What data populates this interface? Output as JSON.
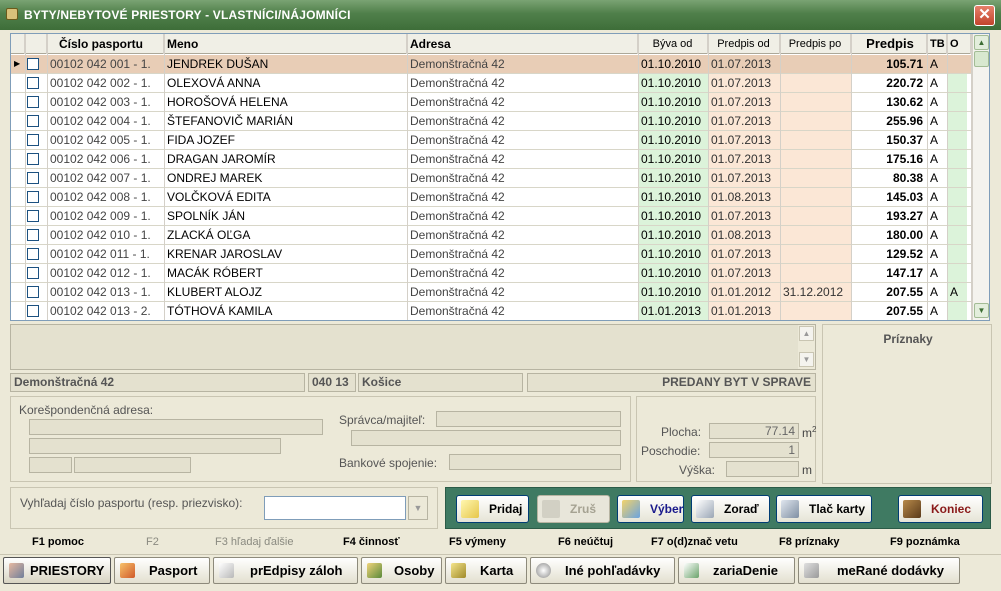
{
  "window": {
    "title": "BYTY/NEBYTOVÉ PRIESTORY - VLASTNÍCI/NÁJOMNÍCI",
    "close_label": "✕"
  },
  "grid": {
    "columns": {
      "pasport": "Číslo pasportu",
      "meno": "Meno",
      "adresa": "Adresa",
      "byva_od": "Býva od",
      "predpis_od": "Predpis od",
      "predpis_po": "Predpis po",
      "predpis": "Predpis",
      "tb": "TB",
      "o": "O"
    },
    "rows": [
      {
        "pasport": "00102 042 001 - 1.",
        "meno": "JENDREK DUŠAN",
        "adresa": "Demonštračná 42",
        "byva_od": "01.10.2010",
        "predpis_od": "01.07.2013",
        "predpis_po": "",
        "predpis": "105.71",
        "tb": "A",
        "o": ""
      },
      {
        "pasport": "00102 042 002 - 1.",
        "meno": "OLEXOVÁ ANNA",
        "adresa": "Demonštračná 42",
        "byva_od": "01.10.2010",
        "predpis_od": "01.07.2013",
        "predpis_po": "",
        "predpis": "220.72",
        "tb": "A",
        "o": ""
      },
      {
        "pasport": "00102 042 003 - 1.",
        "meno": "HOROŠOVÁ HELENA",
        "adresa": "Demonštračná 42",
        "byva_od": "01.10.2010",
        "predpis_od": "01.07.2013",
        "predpis_po": "",
        "predpis": "130.62",
        "tb": "A",
        "o": ""
      },
      {
        "pasport": "00102 042 004 - 1.",
        "meno": "ŠTEFANOVIČ MARIÁN",
        "adresa": "Demonštračná 42",
        "byva_od": "01.10.2010",
        "predpis_od": "01.07.2013",
        "predpis_po": "",
        "predpis": "255.96",
        "tb": "A",
        "o": ""
      },
      {
        "pasport": "00102 042 005 - 1.",
        "meno": "FIDA JOZEF",
        "adresa": "Demonštračná 42",
        "byva_od": "01.10.2010",
        "predpis_od": "01.07.2013",
        "predpis_po": "",
        "predpis": "150.37",
        "tb": "A",
        "o": ""
      },
      {
        "pasport": "00102 042 006 - 1.",
        "meno": "DRAGAN JAROMÍR",
        "adresa": "Demonštračná 42",
        "byva_od": "01.10.2010",
        "predpis_od": "01.07.2013",
        "predpis_po": "",
        "predpis": "175.16",
        "tb": "A",
        "o": ""
      },
      {
        "pasport": "00102 042 007 - 1.",
        "meno": "ONDREJ MAREK",
        "adresa": "Demonštračná 42",
        "byva_od": "01.10.2010",
        "predpis_od": "01.07.2013",
        "predpis_po": "",
        "predpis": "80.38",
        "tb": "A",
        "o": ""
      },
      {
        "pasport": "00102 042 008 - 1.",
        "meno": "VOLČKOVÁ EDITA",
        "adresa": "Demonštračná 42",
        "byva_od": "01.10.2010",
        "predpis_od": "01.08.2013",
        "predpis_po": "",
        "predpis": "145.03",
        "tb": "A",
        "o": ""
      },
      {
        "pasport": "00102 042 009 - 1.",
        "meno": "SPOLNÍK JÁN",
        "adresa": "Demonštračná 42",
        "byva_od": "01.10.2010",
        "predpis_od": "01.07.2013",
        "predpis_po": "",
        "predpis": "193.27",
        "tb": "A",
        "o": ""
      },
      {
        "pasport": "00102 042 010 - 1.",
        "meno": "ZLACKÁ OĽGA",
        "adresa": "Demonštračná 42",
        "byva_od": "01.10.2010",
        "predpis_od": "01.08.2013",
        "predpis_po": "",
        "predpis": "180.00",
        "tb": "A",
        "o": ""
      },
      {
        "pasport": "00102 042 011 - 1.",
        "meno": "KRENAR JAROSLAV",
        "adresa": "Demonštračná 42",
        "byva_od": "01.10.2010",
        "predpis_od": "01.07.2013",
        "predpis_po": "",
        "predpis": "129.52",
        "tb": "A",
        "o": ""
      },
      {
        "pasport": "00102 042 012 - 1.",
        "meno": "MACÁK RÓBERT",
        "adresa": "Demonštračná 42",
        "byva_od": "01.10.2010",
        "predpis_od": "01.07.2013",
        "predpis_po": "",
        "predpis": "147.17",
        "tb": "A",
        "o": ""
      },
      {
        "pasport": "00102 042 013 - 1.",
        "meno": "KLUBERT ALOJZ",
        "adresa": "Demonštračná 42",
        "byva_od": "01.10.2010",
        "predpis_od": "01.01.2012",
        "predpis_po": "31.12.2012",
        "predpis": "207.55",
        "tb": "A",
        "o": "A"
      },
      {
        "pasport": "00102 042 013 - 2.",
        "meno": "TÓTHOVÁ KAMILA",
        "adresa": "Demonštračná 42",
        "byva_od": "01.01.2013",
        "predpis_od": "01.01.2013",
        "predpis_po": "",
        "predpis": "207.55",
        "tb": "A",
        "o": ""
      }
    ]
  },
  "info": {
    "address": "Demonštračná 42",
    "code": "040 13",
    "city": "Košice",
    "status": "PREDANY BYT V SPRAVE"
  },
  "priznaky": {
    "title": "Príznaky"
  },
  "koresp": {
    "label": "Korešpondenčná adresa:",
    "spravca_label": "Správca/majiteľ:",
    "bank_label": "Bankové spojenie:"
  },
  "props": {
    "plocha_label": "Plocha:",
    "plocha_value": "77.14",
    "plocha_unit": "m",
    "plocha_sup": "2",
    "poschodie_label": "Poschodie:",
    "poschodie_value": "1",
    "vyska_label": "Výška:",
    "vyska_value": "",
    "vyska_unit": "m"
  },
  "search": {
    "label": "Vyhľadaj číslo pasportu (resp. priezvisko):",
    "value": ""
  },
  "buttons": {
    "pridaj": "Pridaj",
    "zrus": "Zruš",
    "vyber": "Výber",
    "zorad": "Zoraď",
    "tlac": "Tlač karty",
    "koniec": "Koniec"
  },
  "fkeys": [
    "F1 pomoc",
    "F2",
    "F3 hľadaj ďalšie",
    "F4 činnosť",
    "F5 výmeny",
    "F6 neúčtuj",
    "F7 o(d)znač vetu",
    "F8 príznaky",
    "F9 poznámka"
  ],
  "tabs": {
    "priestory": "PRIESTORY",
    "pasport": "Pasport",
    "predpisy": "prEdpisy záloh",
    "osoby": "Osoby",
    "karta": "Karta",
    "ine": "Iné pohľadávky",
    "zariadenie": "zariaDenie",
    "merane": "meRané dodávky"
  },
  "colors": {
    "title_bar": "#4f7f4a",
    "selected_row": "#e8cdb6",
    "green_col": "#dcf3da",
    "peach_col": "#fbe7d6",
    "button_bar": "#3f7a62"
  }
}
